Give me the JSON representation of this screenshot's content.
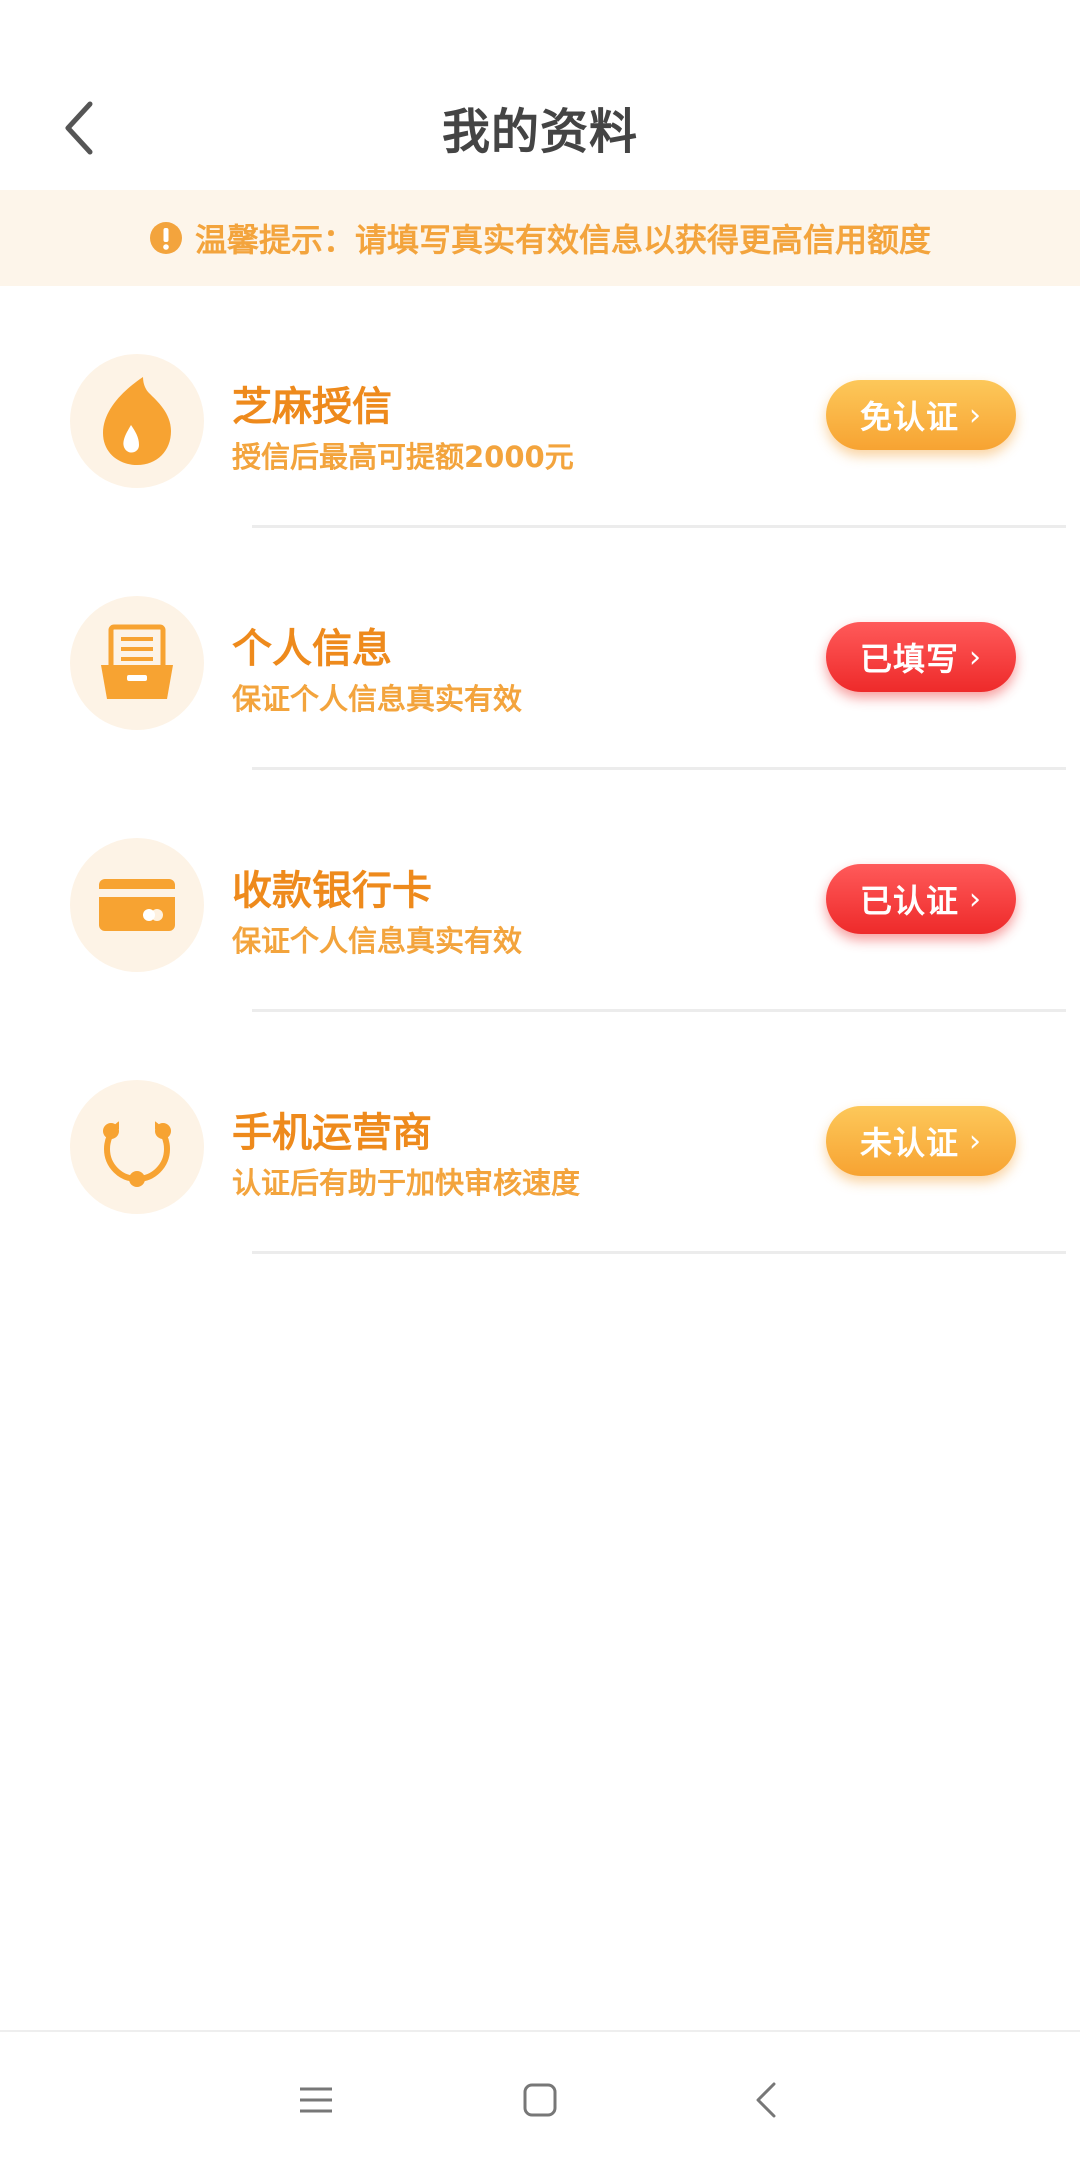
{
  "header": {
    "title": "我的资料",
    "back_icon": "chevron-left-icon"
  },
  "notice": {
    "icon": "exclamation-circle-icon",
    "text": "温馨提示：请填写真实有效信息以获得更高信用额度"
  },
  "items": [
    {
      "icon": "sesame-drop-icon",
      "title": "芝麻授信",
      "subtitle": "授信后最高可提额2000元",
      "button": "免认证",
      "button_color": "#f7a332"
    },
    {
      "icon": "document-tray-icon",
      "title": "个人信息",
      "subtitle": "保证个人信息真实有效",
      "button": "已填写",
      "button_color": "#ee2a2a"
    },
    {
      "icon": "bank-card-icon",
      "title": "收款银行卡",
      "subtitle": "保证个人信息真实有效",
      "button": "已认证",
      "button_color": "#ee2a2a"
    },
    {
      "icon": "network-nodes-icon",
      "title": "手机运营商",
      "subtitle": "认证后有助于加快审核速度",
      "button": "未认证",
      "button_color": "#f7a332"
    }
  ],
  "colors": {
    "accent_orange": "#ee8a1c",
    "notice_bg": "#fdf5ea",
    "red": "#ee2a2a"
  },
  "system_nav": {
    "menu_icon": "menu-icon",
    "home_icon": "home-square-icon",
    "back_icon": "back-triangle-icon"
  }
}
